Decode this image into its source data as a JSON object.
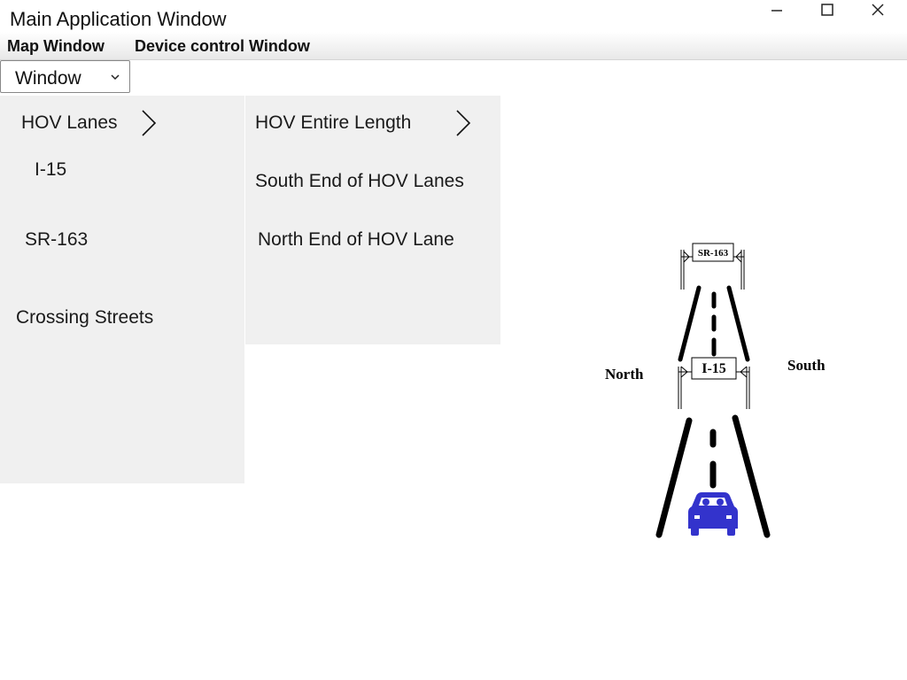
{
  "window": {
    "title": "Main Application Window",
    "controls": [
      "minimize",
      "maximize",
      "close"
    ]
  },
  "menubar": {
    "items": [
      {
        "label": "Map Window"
      },
      {
        "label": "Device control Window"
      }
    ]
  },
  "dropdown": {
    "value": "Window"
  },
  "menu_level1": {
    "items": [
      {
        "label": "HOV Lanes",
        "has_submenu": true
      },
      {
        "label": "I-15"
      },
      {
        "label": "SR-163"
      },
      {
        "label": "Crossing Streets"
      }
    ]
  },
  "menu_level2": {
    "items": [
      {
        "label": "HOV Entire Length",
        "has_submenu": true
      },
      {
        "label": "South End of HOV Lanes"
      },
      {
        "label": "North End of HOV Lane"
      }
    ]
  },
  "map": {
    "sign_top": "SR-163",
    "sign_bottom": "I-15",
    "label_left": "North",
    "label_right": "South",
    "car_color": "#3333cc",
    "road_color": "#000000"
  }
}
